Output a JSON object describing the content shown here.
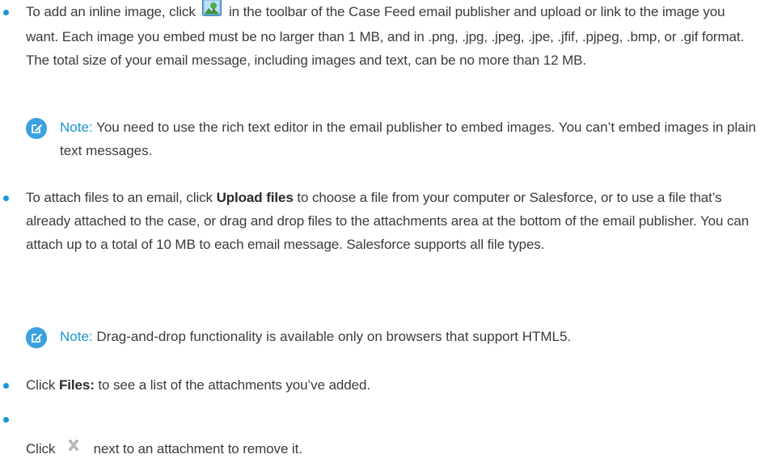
{
  "items": [
    {
      "p1": "To add an inline image, click",
      "p2": "in the toolbar of the Case Feed email publisher and upload or link to the image you want. Each image you embed must be no larger than 1 MB, and in .png, .jpg, .jpeg, .jpe, .jfif, .pjpeg, .bmp, or .gif format. The total size of your email message, including images and text, can be no more than 12 MB.",
      "icon": "insert-image-icon"
    },
    {
      "note_label": "Note:",
      "note_text": "You need to use the rich text editor in the email publisher to embed images. You can’t embed images in plain text messages."
    },
    {
      "p1": "To attach files to an email, click",
      "bold": "Upload files",
      "p2": "to choose a file from your computer or Salesforce, or to use a file that’s already attached to the case, or drag and drop files to the attachments area at the bottom of the email publisher. You can attach up to a total of 10 MB to each email message. Salesforce supports all file types."
    },
    {
      "note_label": "Note:",
      "note_text": "Drag-and-drop functionality is available only on browsers that support HTML5."
    },
    {
      "p1": "Click",
      "bold": "Files:",
      "p2": "to see a list of the attachments you’ve added."
    },
    {
      "p1": "Click",
      "p2": "next to an attachment to remove it.",
      "icon": "remove-x-icon"
    }
  ],
  "colors": {
    "accent": "#1b96d3",
    "text": "#3b3b3b",
    "note_icon": "#3ba1e0"
  }
}
